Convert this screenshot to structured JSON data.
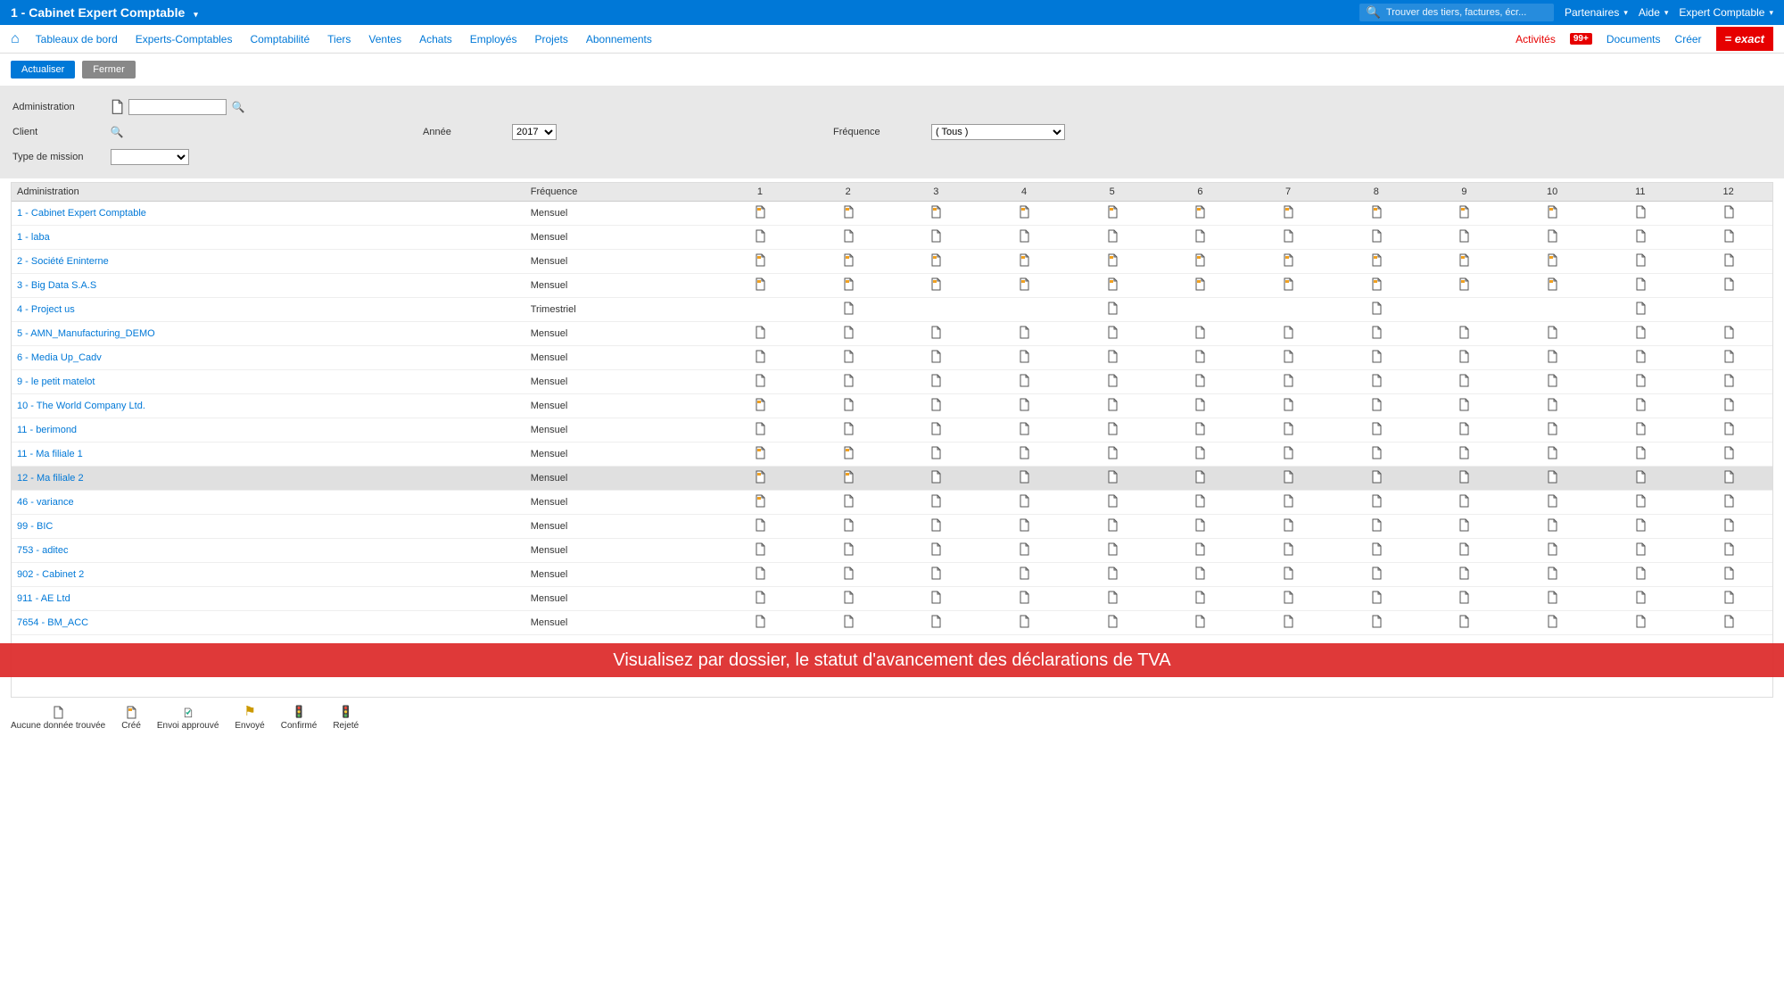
{
  "header": {
    "title": "1 - Cabinet Expert Comptable",
    "search_placeholder": "Trouver des tiers, factures, écr...",
    "links": {
      "partenaires": "Partenaires",
      "aide": "Aide",
      "user": "Expert Comptable"
    }
  },
  "nav": {
    "items": [
      "Tableaux de bord",
      "Experts-Comptables",
      "Comptabilité",
      "Tiers",
      "Ventes",
      "Achats",
      "Employés",
      "Projets",
      "Abonnements"
    ],
    "right": {
      "activites": "Activités",
      "badge": "99+",
      "documents": "Documents",
      "creer": "Créer",
      "logo": "= exact"
    }
  },
  "actions": {
    "refresh": "Actualiser",
    "close": "Fermer"
  },
  "filters": {
    "administration_label": "Administration",
    "client_label": "Client",
    "type_mission_label": "Type de mission",
    "annee_label": "Année",
    "annee_value": "2017",
    "frequence_label": "Fréquence",
    "frequence_value": "( Tous )"
  },
  "columns": {
    "administration": "Administration",
    "frequence": "Fréquence",
    "months": [
      "1",
      "2",
      "3",
      "4",
      "5",
      "6",
      "7",
      "8",
      "9",
      "10",
      "11",
      "12"
    ]
  },
  "rows": [
    {
      "name": "1 - Cabinet Expert Comptable",
      "freq": "Mensuel",
      "status": [
        "c",
        "c",
        "c",
        "c",
        "c",
        "c",
        "c",
        "c",
        "c",
        "c",
        "b",
        "b"
      ]
    },
    {
      "name": "1 - laba",
      "freq": "Mensuel",
      "status": [
        "b",
        "b",
        "b",
        "b",
        "b",
        "b",
        "b",
        "b",
        "b",
        "b",
        "b",
        "b"
      ]
    },
    {
      "name": "2 - Société Eninterne",
      "freq": "Mensuel",
      "status": [
        "c",
        "c",
        "c",
        "c",
        "c",
        "c",
        "c",
        "c",
        "c",
        "c",
        "b",
        "b"
      ]
    },
    {
      "name": "3 - Big Data S.A.S",
      "freq": "Mensuel",
      "status": [
        "c",
        "c",
        "c",
        "c",
        "c",
        "c",
        "c",
        "c",
        "c",
        "c",
        "b",
        "b"
      ]
    },
    {
      "name": "4 - Project us",
      "freq": "Trimestriel",
      "status": [
        "",
        "b",
        "",
        "",
        "b",
        "",
        "",
        "b",
        "",
        "",
        "b",
        ""
      ]
    },
    {
      "name": "5 - AMN_Manufacturing_DEMO",
      "freq": "Mensuel",
      "status": [
        "b",
        "b",
        "b",
        "b",
        "b",
        "b",
        "b",
        "b",
        "b",
        "b",
        "b",
        "b"
      ]
    },
    {
      "name": "6 - Media Up_Cadv",
      "freq": "Mensuel",
      "status": [
        "b",
        "b",
        "b",
        "b",
        "b",
        "b",
        "b",
        "b",
        "b",
        "b",
        "b",
        "b"
      ]
    },
    {
      "name": "9 - le petit matelot",
      "freq": "Mensuel",
      "status": [
        "b",
        "b",
        "b",
        "b",
        "b",
        "b",
        "b",
        "b",
        "b",
        "b",
        "b",
        "b"
      ]
    },
    {
      "name": "10 - The World Company Ltd.",
      "freq": "Mensuel",
      "status": [
        "c",
        "b",
        "b",
        "b",
        "b",
        "b",
        "b",
        "b",
        "b",
        "b",
        "b",
        "b"
      ]
    },
    {
      "name": "11 - berimond",
      "freq": "Mensuel",
      "status": [
        "b",
        "b",
        "b",
        "b",
        "b",
        "b",
        "b",
        "b",
        "b",
        "b",
        "b",
        "b"
      ]
    },
    {
      "name": "11 - Ma filiale 1",
      "freq": "Mensuel",
      "status": [
        "c",
        "c",
        "b",
        "b",
        "b",
        "b",
        "b",
        "b",
        "b",
        "b",
        "b",
        "b"
      ]
    },
    {
      "name": "12 - Ma filiale 2",
      "freq": "Mensuel",
      "status": [
        "c",
        "c",
        "b",
        "b",
        "b",
        "b",
        "b",
        "b",
        "b",
        "b",
        "b",
        "b"
      ],
      "active": true
    },
    {
      "name": "46 - variance",
      "freq": "Mensuel",
      "status": [
        "c",
        "b",
        "b",
        "b",
        "b",
        "b",
        "b",
        "b",
        "b",
        "b",
        "b",
        "b"
      ]
    },
    {
      "name": "99 - BIC",
      "freq": "Mensuel",
      "status": [
        "b",
        "b",
        "b",
        "b",
        "b",
        "b",
        "b",
        "b",
        "b",
        "b",
        "b",
        "b"
      ]
    },
    {
      "name": "753 - aditec",
      "freq": "Mensuel",
      "status": [
        "b",
        "b",
        "b",
        "b",
        "b",
        "b",
        "b",
        "b",
        "b",
        "b",
        "b",
        "b"
      ]
    },
    {
      "name": "902 - Cabinet 2",
      "freq": "Mensuel",
      "status": [
        "b",
        "b",
        "b",
        "b",
        "b",
        "b",
        "b",
        "b",
        "b",
        "b",
        "b",
        "b"
      ]
    },
    {
      "name": "911 - AE Ltd",
      "freq": "Mensuel",
      "status": [
        "b",
        "b",
        "b",
        "b",
        "b",
        "b",
        "b",
        "b",
        "b",
        "b",
        "b",
        "b"
      ]
    },
    {
      "name": "7654 - BM_ACC",
      "freq": "Mensuel",
      "status": [
        "b",
        "b",
        "b",
        "b",
        "b",
        "b",
        "b",
        "b",
        "b",
        "b",
        "b",
        "b"
      ]
    }
  ],
  "legend": {
    "none": "Aucune donnée trouvée",
    "created": "Créé",
    "approved": "Envoi approuvé",
    "sent": "Envoyé",
    "confirmed": "Confirmé",
    "rejected": "Rejeté"
  },
  "banner": "Visualisez par dossier, le statut d'avancement des déclarations de TVA"
}
